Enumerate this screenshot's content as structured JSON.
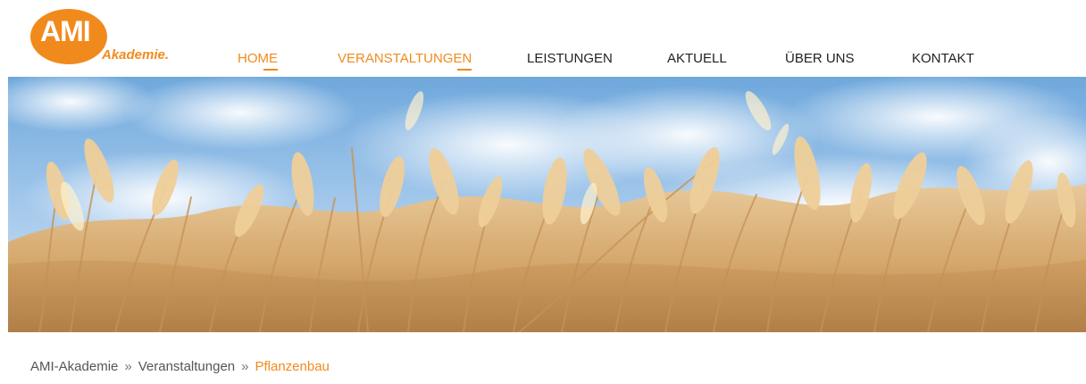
{
  "brand": {
    "logo_main": "AMI",
    "logo_sub": "Akademie.",
    "accent_color": "#f18a1d"
  },
  "nav": {
    "items": [
      {
        "label": "HOME",
        "active": true
      },
      {
        "label": "VERANSTALTUNGEN",
        "active": true
      },
      {
        "label": "LEISTUNGEN",
        "active": false
      },
      {
        "label": "AKTUELL",
        "active": false
      },
      {
        "label": "ÜBER UNS",
        "active": false
      },
      {
        "label": "KONTAKT",
        "active": false
      }
    ]
  },
  "hero": {
    "image_description": "wheat-field-under-blue-sky"
  },
  "breadcrumb": {
    "items": [
      {
        "label": "AMI-Akademie",
        "current": false
      },
      {
        "label": "Veranstaltungen",
        "current": false
      },
      {
        "label": "Pflanzenbau",
        "current": true
      }
    ],
    "separator": "»"
  }
}
